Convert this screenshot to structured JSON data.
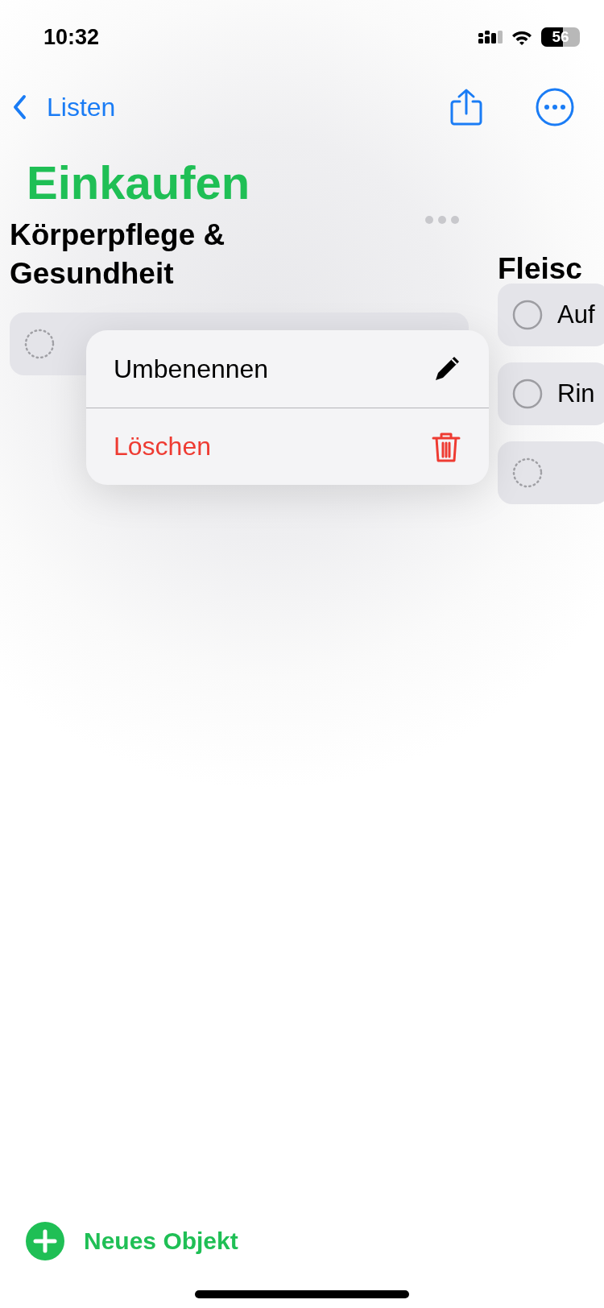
{
  "status_bar": {
    "time": "10:32",
    "battery": "56"
  },
  "nav": {
    "back_label": "Listen"
  },
  "title": "Einkaufen",
  "columns": [
    {
      "heading": "Körperpflege & Gesundheit",
      "items": [
        {
          "kind": "placeholder"
        }
      ]
    },
    {
      "heading": "Fleisc",
      "items": [
        {
          "kind": "task",
          "text": "Auf",
          "checked": false
        },
        {
          "kind": "task",
          "text": "Rin",
          "checked": false
        },
        {
          "kind": "placeholder"
        }
      ]
    }
  ],
  "context_menu": {
    "items": [
      {
        "kind": "rename",
        "label": "Umbenennen"
      },
      {
        "kind": "delete",
        "label": "Löschen"
      }
    ]
  },
  "add_button": {
    "label": "Neues Objekt"
  }
}
